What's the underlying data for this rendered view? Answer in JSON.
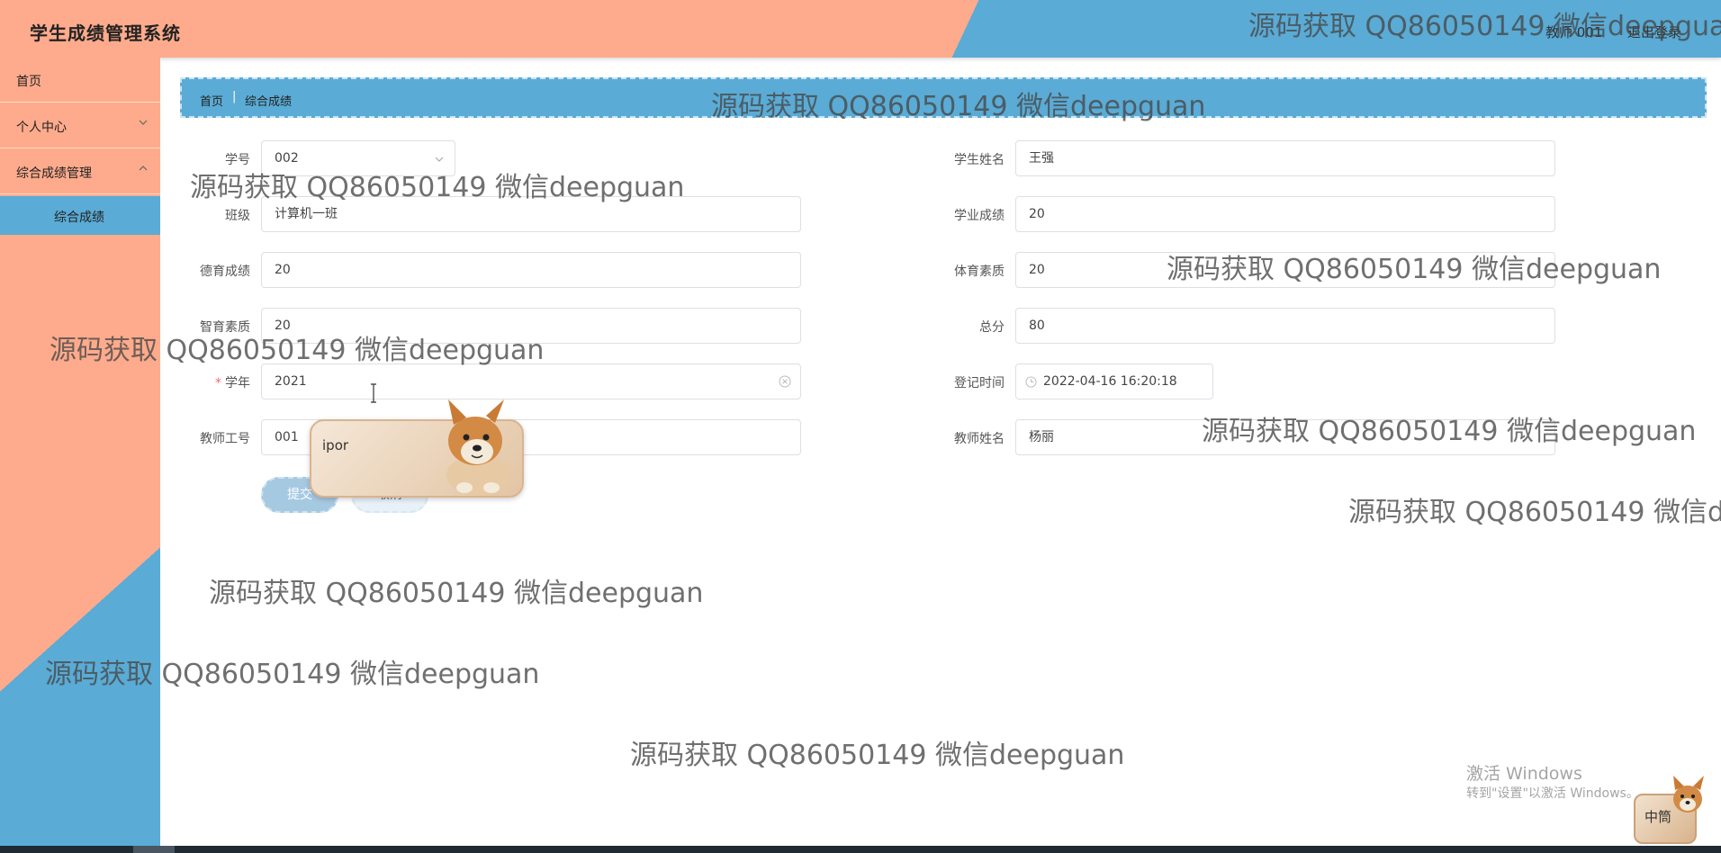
{
  "header": {
    "title": "学生成绩管理系统",
    "user_label": "教师 001",
    "logout_label": "退出登录"
  },
  "sidebar": {
    "items": [
      {
        "label": "首页"
      },
      {
        "label": "个人中心"
      },
      {
        "label": "综合成绩管理"
      }
    ],
    "sub_items": [
      {
        "label": "综合成绩"
      }
    ]
  },
  "breadcrumb": {
    "home": "首页",
    "separator": "|",
    "current": "综合成绩"
  },
  "form": {
    "student_id": {
      "label": "学号",
      "value": "002"
    },
    "student_name": {
      "label": "学生姓名",
      "value": "王强"
    },
    "class": {
      "label": "班级",
      "value": "计算机一班"
    },
    "academic_score": {
      "label": "学业成绩",
      "value": "20"
    },
    "moral_score": {
      "label": "德育成绩",
      "value": "20"
    },
    "sports_quality": {
      "label": "体育素质",
      "value": "20"
    },
    "intellect_quality": {
      "label": "智育素质",
      "value": "20"
    },
    "total_score": {
      "label": "总分",
      "value": "80"
    },
    "school_year": {
      "label": "学年",
      "required_mark": "*",
      "value": "2021"
    },
    "register_time": {
      "label": "登记时间",
      "value": "2022-04-16 16:20:18"
    },
    "teacher_id": {
      "label": "教师工号",
      "value": "001"
    },
    "teacher_name": {
      "label": "教师姓名",
      "value": "杨丽"
    },
    "submit_label": "提交",
    "cancel_label": "取消"
  },
  "ime_popup": {
    "text": "ipor"
  },
  "watermark": {
    "text": "源码获取 QQ86050149 微信deepguan"
  },
  "windows_activation": {
    "title": "激活 Windows",
    "subtitle": "转到\"设置\"以激活 Windows。"
  },
  "ime_badge": {
    "label": "中筒"
  },
  "colors": {
    "salmon": "#fdab8c",
    "blue": "#5aabd5",
    "submit": "#a6c9e2"
  }
}
